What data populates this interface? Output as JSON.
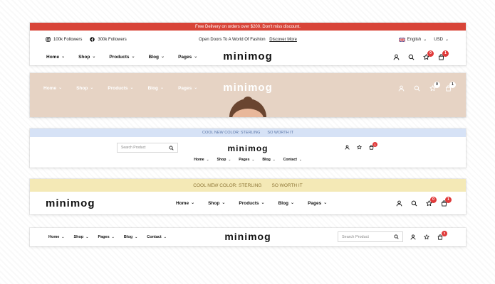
{
  "colors": {
    "announce_red": "#d84438",
    "announce_blue": "#d6e2f6",
    "announce_yellow": "#f4e9b6",
    "hero_beige": "#e6d3c4",
    "badge_red": "#e03a3a"
  },
  "header1": {
    "announcement": "Free Delivery on orders over $200. Don't miss discount.",
    "instagram_followers": "100k Followers",
    "facebook_followers": "300k Followers",
    "promo_text": "Open Doors To A World Of Fashion",
    "promo_link": "Discover More",
    "language": "English",
    "currency": "USD",
    "nav": [
      "Home",
      "Shop",
      "Products",
      "Blog",
      "Pages"
    ],
    "logo": "minimog",
    "wishlist_count": "0",
    "cart_count": "1"
  },
  "header2": {
    "nav": [
      "Home",
      "Shop",
      "Products",
      "Blog",
      "Pages"
    ],
    "logo": "minimog",
    "wishlist_count": "0",
    "cart_count": "1"
  },
  "header3": {
    "announcement": "COOL NEW COLOR: STERLING",
    "announcement_link": "SO WORTH IT",
    "search_placeholder": "Search Product",
    "logo": "minimog",
    "nav": [
      "Home",
      "Shop",
      "Pages",
      "Blog",
      "Contact"
    ],
    "cart_count": "1"
  },
  "header4": {
    "announcement": "COOL NEW COLOR: STERLING",
    "announcement_link": "SO WORTH IT",
    "logo": "minimog",
    "nav": [
      "Home",
      "Shop",
      "Products",
      "Blog",
      "Pages"
    ],
    "wishlist_count": "0",
    "cart_count": "1"
  },
  "header5": {
    "nav": [
      "Home",
      "Shop",
      "Pages",
      "Blog",
      "Contact"
    ],
    "logo": "minimog",
    "search_placeholder": "Search Product",
    "cart_count": "1"
  }
}
